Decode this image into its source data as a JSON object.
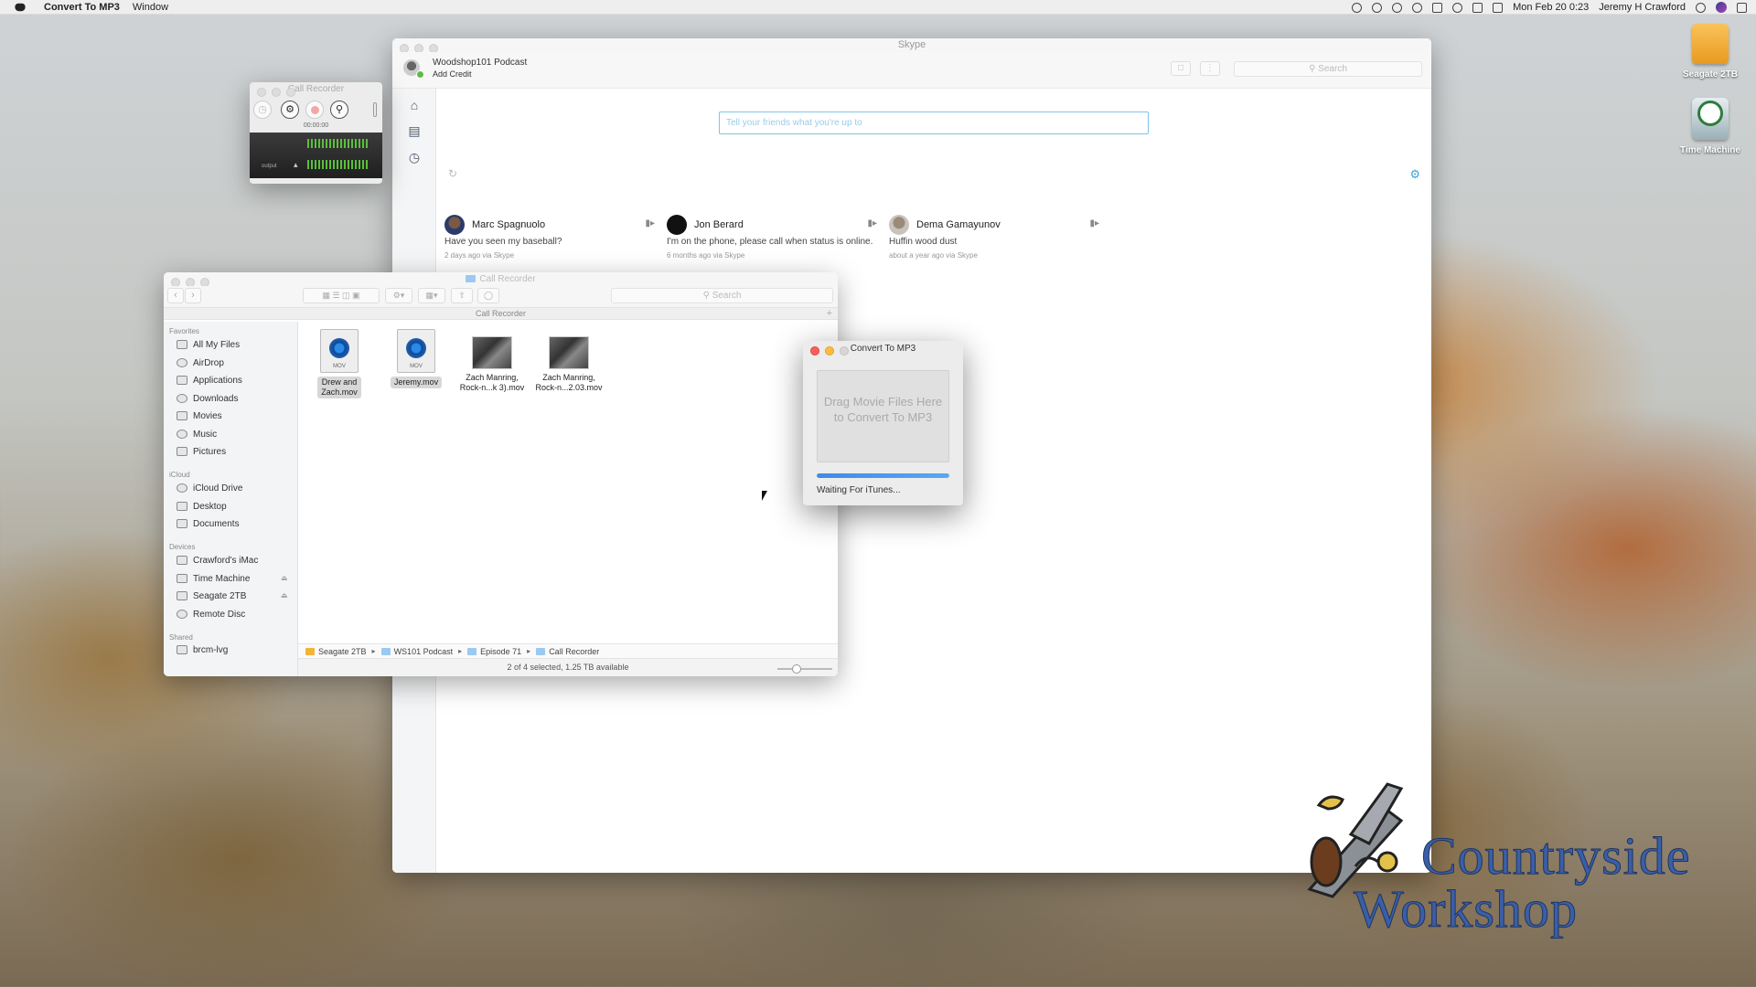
{
  "menubar": {
    "app_name": "Convert To MP3",
    "menus": [
      "Window"
    ],
    "clock": "Mon Feb 20  0:23",
    "user": "Jeremy H Crawford"
  },
  "desktop": {
    "icons": [
      {
        "label": "Seagate 2TB",
        "icon": "drive-icon"
      },
      {
        "label": "Time Machine",
        "icon": "time-machine-icon"
      }
    ]
  },
  "skype": {
    "window_title": "Skype",
    "profile_name": "Woodshop101 Podcast",
    "add_credit": "Add Credit",
    "search_placeholder": "Search",
    "mood_placeholder": "Tell your friends what you're up to",
    "contacts": [
      {
        "name": "Marc Spagnuolo",
        "message": "Have you seen my baseball?",
        "time": "2 days ago via Skype"
      },
      {
        "name": "Jon Berard",
        "message": "I'm on the phone, please call when status is online.",
        "time": "6 months ago via Skype"
      },
      {
        "name": "Dema Gamayunov",
        "message": "Huffin wood dust",
        "time": "about a year ago via Skype"
      }
    ]
  },
  "call_recorder": {
    "title": "Call Recorder",
    "timer": "00:00:00",
    "meter_label": "output"
  },
  "finder": {
    "title": "Call Recorder",
    "path_header": "Call Recorder",
    "search_placeholder": "Search",
    "sidebar": {
      "favorites_title": "Favorites",
      "favorites": [
        "All My Files",
        "AirDrop",
        "Applications",
        "Downloads",
        "Movies",
        "Music",
        "Pictures"
      ],
      "icloud_title": "iCloud",
      "icloud": [
        "iCloud Drive",
        "Desktop",
        "Documents"
      ],
      "devices_title": "Devices",
      "devices": [
        "Crawford's iMac",
        "Time Machine",
        "Seagate 2TB",
        "Remote Disc"
      ],
      "shared_title": "Shared",
      "shared": [
        "brcm-lvg"
      ]
    },
    "files": [
      {
        "name_line1": "Drew and",
        "name_line2": "Zach.mov",
        "tag": "MOV",
        "selected": true
      },
      {
        "name_line1": "Jeremy.mov",
        "name_line2": "",
        "tag": "MOV",
        "selected": true
      },
      {
        "name_line1": "Zach Manring,",
        "name_line2": "Rock-n...k 3).mov",
        "tag": "",
        "selected": false
      },
      {
        "name_line1": "Zach Manring,",
        "name_line2": "Rock-n...2.03.mov",
        "tag": "",
        "selected": false
      }
    ],
    "path": [
      "Seagate 2TB",
      "WS101 Podcast",
      "Episode 71",
      "Call Recorder"
    ],
    "status": "2 of 4 selected, 1.25 TB available"
  },
  "converter": {
    "title": "Convert To MP3",
    "dropzone_line1": "Drag Movie Files Here",
    "dropzone_line2": "to Convert To MP3",
    "progress": 1.0,
    "status": "Waiting For iTunes..."
  },
  "logo": {
    "line1": "Countryside",
    "line2": "Workshop"
  }
}
